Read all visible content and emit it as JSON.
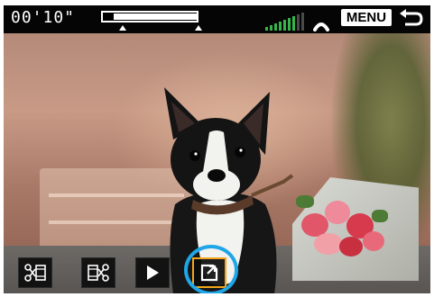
{
  "status_bar": {
    "elapsed_time": "00'10\"",
    "edit_range_fraction_start": 0.12,
    "edit_range_fraction_end": 1.0,
    "menu_label": "MENU",
    "signal_icon": "signal-strength-icon",
    "wireless_icon": "wireless-arc-icon",
    "back_icon": "return-arrow-icon"
  },
  "toolbar": {
    "tools": [
      {
        "name": "cut-beginning",
        "icon": "cut-beginning-icon"
      },
      {
        "name": "cut-end",
        "icon": "cut-end-icon"
      },
      {
        "name": "play",
        "icon": "play-icon"
      },
      {
        "name": "save",
        "icon": "save-icon",
        "selected": true
      }
    ]
  },
  "colors": {
    "selection_border": "#f3a51d",
    "highlight_ring": "#1fa6e8",
    "signal_active": "#37b54a"
  }
}
